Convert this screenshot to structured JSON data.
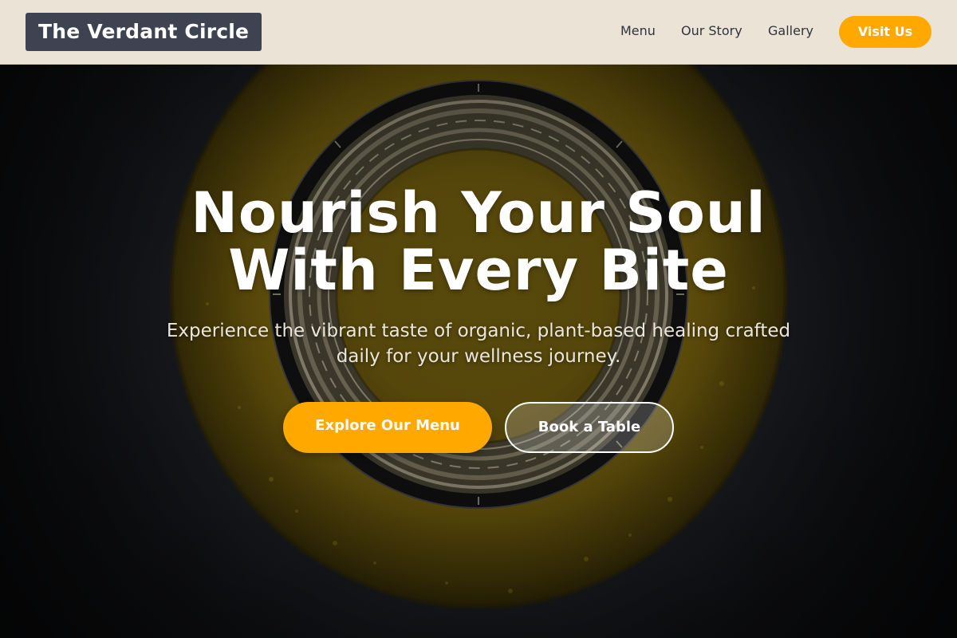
{
  "header": {
    "brand": "The Verdant Circle",
    "nav": {
      "menu": "Menu",
      "our_story": "Our Story",
      "gallery": "Gallery"
    },
    "cta_label": "Visit Us"
  },
  "hero": {
    "title_line1": "Nourish Your Soul",
    "title_line2": "With Every Bite",
    "subtitle": "Experience the vibrant taste of organic, plant-based healing crafted daily for your wellness journey.",
    "primary_button": "Explore Our Menu",
    "secondary_button": "Book a Table",
    "background_image": "olive-oil-bottle-top-view-photo"
  },
  "colors": {
    "accent": "#ffa800",
    "header_bg": "#ebe3d5",
    "logo_bg": "#3d4350",
    "hero_bg": "#15171b"
  }
}
